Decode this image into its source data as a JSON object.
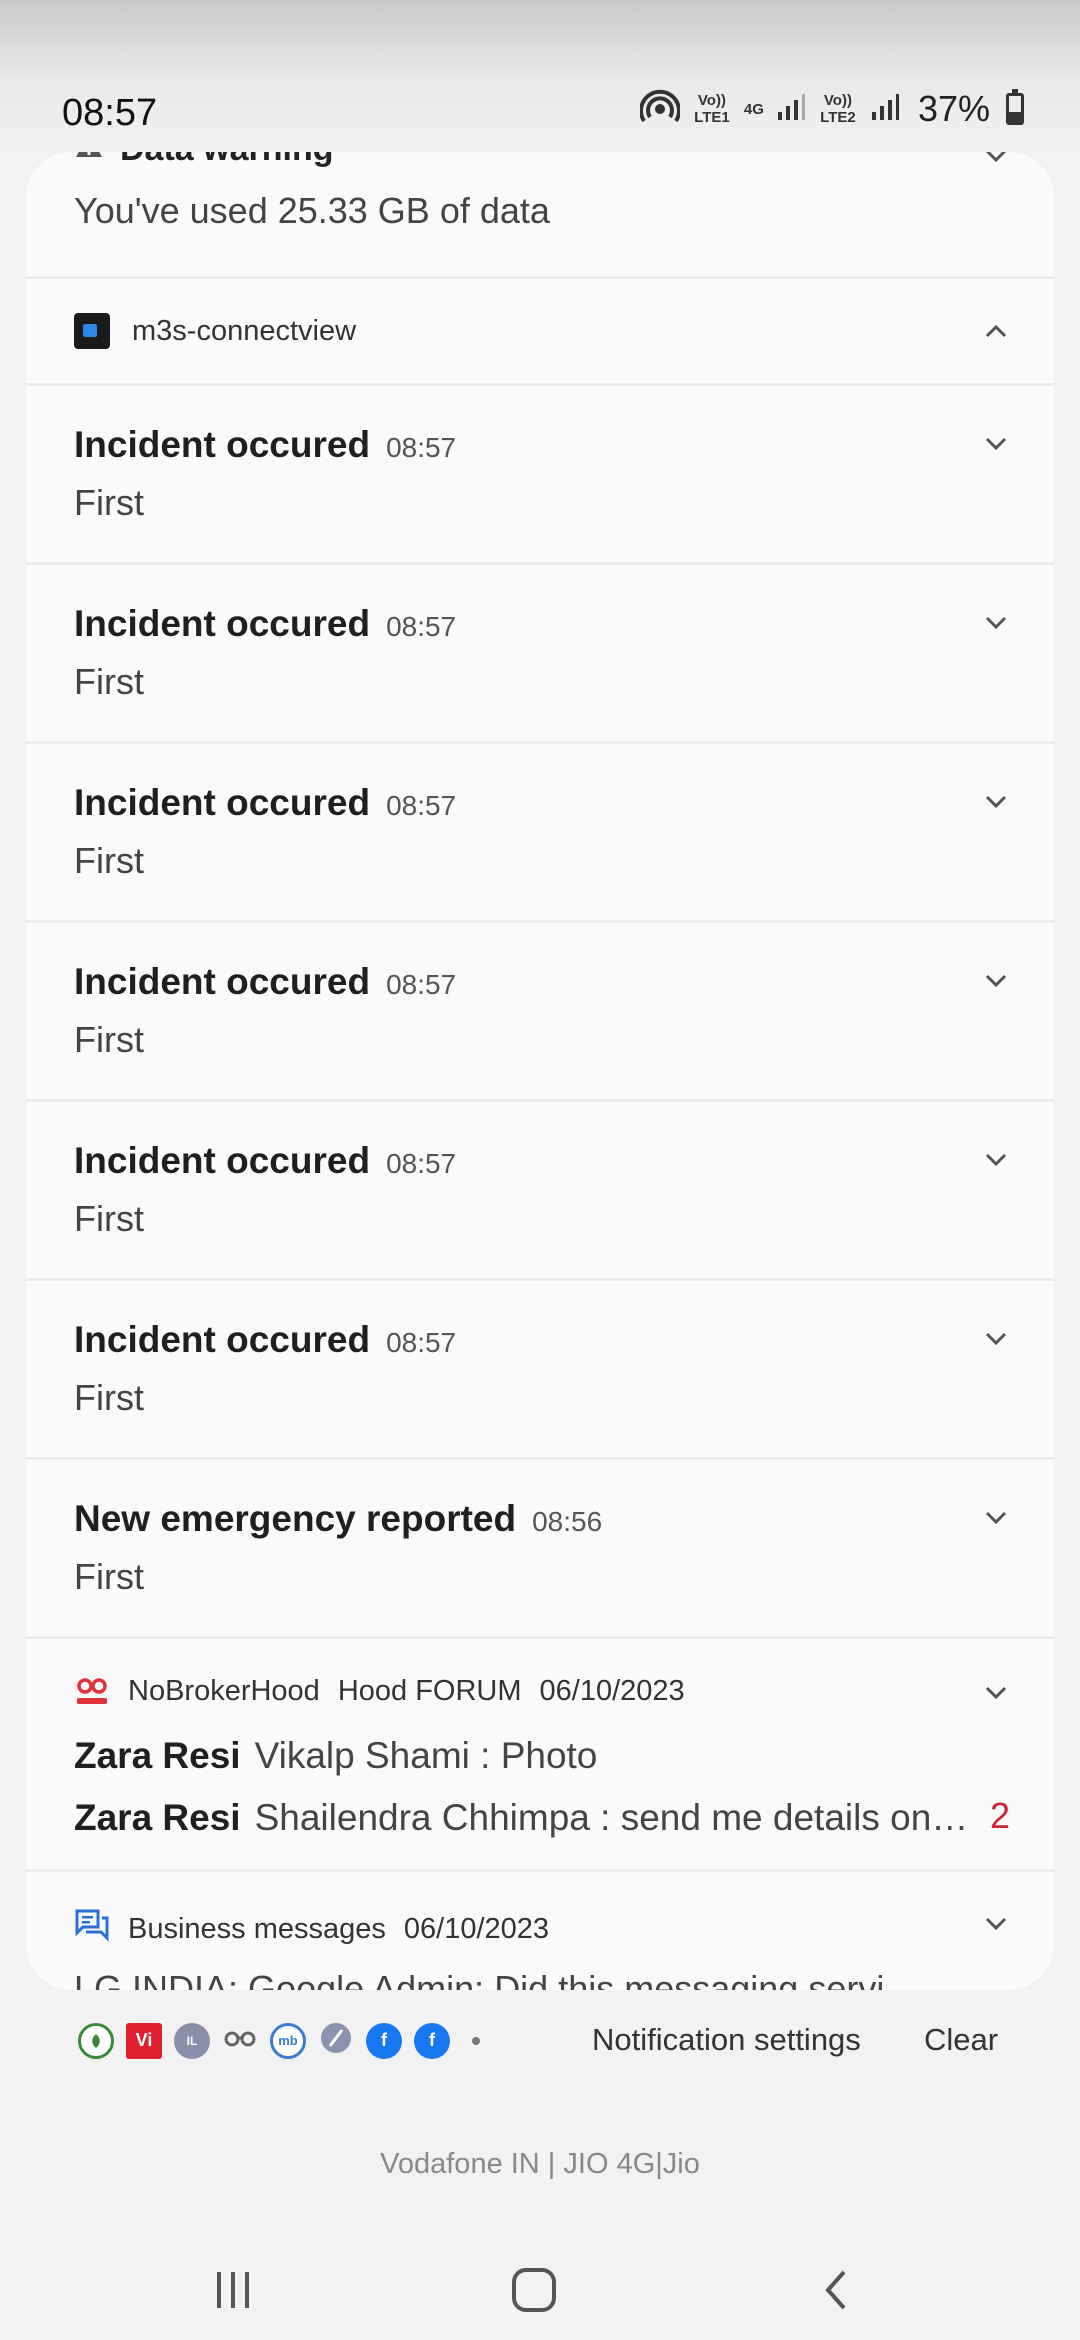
{
  "status_bar": {
    "time": "08:57",
    "sim1_label": "Vo)) LTE1",
    "net_label": "4G",
    "sim2_label": "Vo)) LTE2",
    "battery_text": "37%",
    "battery_level": 0.37
  },
  "data_warning": {
    "title": "Data warning",
    "text": "You've used 25.33 GB of data"
  },
  "group": {
    "app_name": "m3s-connectview"
  },
  "notifications": [
    {
      "title": "Incident occured",
      "time": "08:57",
      "body": "First"
    },
    {
      "title": "Incident occured",
      "time": "08:57",
      "body": "First"
    },
    {
      "title": "Incident occured",
      "time": "08:57",
      "body": "First"
    },
    {
      "title": "Incident occured",
      "time": "08:57",
      "body": "First"
    },
    {
      "title": "Incident occured",
      "time": "08:57",
      "body": "First"
    },
    {
      "title": "Incident occured",
      "time": "08:57",
      "body": "First"
    },
    {
      "title": "New emergency reported",
      "time": "08:56",
      "body": "First"
    }
  ],
  "nobroker": {
    "app_name": "NoBrokerHood",
    "sub": "Hood FORUM",
    "date": "06/10/2023",
    "lines": [
      {
        "sender": "Zara Resi",
        "text": "Vikalp Shami : Photo"
      },
      {
        "sender": "Zara Resi",
        "text": "Shailendra Chhimpa : send me details on…"
      }
    ],
    "count": "2"
  },
  "business": {
    "app_name": "Business messages",
    "date": "06/10/2023",
    "text": "LG INDIA: Google Admin: Did this messaging servi"
  },
  "footer": {
    "settings_label": "Notification settings",
    "clear_label": "Clear",
    "carrier": "Vodafone IN | JIO 4G|Jio"
  }
}
